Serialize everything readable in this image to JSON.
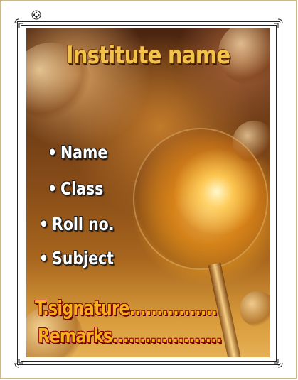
{
  "cover": {
    "institute_name": "Institute name",
    "fields": [
      "Name",
      "Class",
      "Roll no.",
      "Subject"
    ],
    "bullet": "•",
    "signature_label": "T.signature................",
    "remarks_label": "Remarks...................."
  },
  "colors": {
    "title": "#f2c34c",
    "field_text": "#ffffff",
    "signature_text": "#f2b21e",
    "signature_outline": "#8b0000"
  },
  "icons": [
    "move-handle-icon",
    "corner-ornament-icon"
  ]
}
